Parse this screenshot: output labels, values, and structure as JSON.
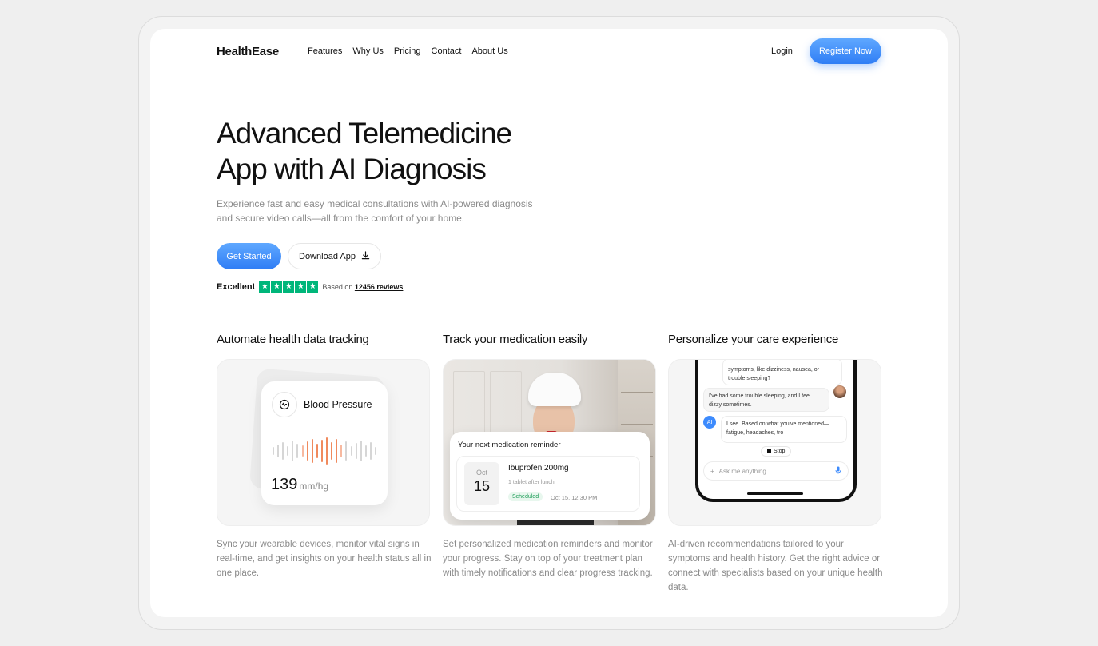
{
  "nav": {
    "logo": "HealthEase",
    "links": [
      "Features",
      "Why Us",
      "Pricing",
      "Contact",
      "About Us"
    ],
    "login": "Login",
    "register": "Register Now"
  },
  "hero": {
    "title_line1": "Advanced Telemedicine",
    "title_line2": "App with AI Diagnosis",
    "subtitle": "Experience fast and easy medical consultations with AI-powered diagnosis and secure video calls—all from the comfort of your home.",
    "cta_primary": "Get Started",
    "cta_secondary": "Download App",
    "rating_label": "Excellent",
    "rating_stars": 5,
    "reviews_prefix": "Based on",
    "reviews_count": "12456 reviews"
  },
  "features": [
    {
      "title": "Automate health data tracking",
      "description": "Sync your wearable devices, monitor vital signs in real-time, and get insights on your health status all in one place."
    },
    {
      "title": "Track your medication easily",
      "description": "Set personalized medication reminders and monitor your progress. Stay on top of your treatment plan with timely notifications and clear progress tracking."
    },
    {
      "title": "Personalize your care experience",
      "description": "AI-driven recommendations tailored to your symptoms and health history. Get the right advice or connect with specialists based on your unique health data."
    }
  ],
  "blood_pressure": {
    "label": "Blood Pressure",
    "value": "139",
    "unit": "mm/hg"
  },
  "reminder": {
    "title": "Your next medication reminder",
    "month": "Oct",
    "day": "15",
    "medication": "Ibuprofen 200mg",
    "instruction": "1 tablet after lunch",
    "status": "Scheduled",
    "datetime": "Oct 15, 12:30 PM"
  },
  "chat": {
    "msg1": "symptoms, like dizziness, nausea, or trouble sleeping?",
    "msg2": "I've had some trouble sleeping, and I feel dizzy sometimes.",
    "ai_badge": "AI",
    "msg3": "I see. Based on what you've mentioned—fatigue, headaches, tro",
    "stop": "Stop",
    "placeholder": "Ask me anything"
  },
  "colors": {
    "accent": "#2f7df5",
    "trustpilot_green": "#00b67a",
    "wave_orange": "#f08a5d"
  }
}
